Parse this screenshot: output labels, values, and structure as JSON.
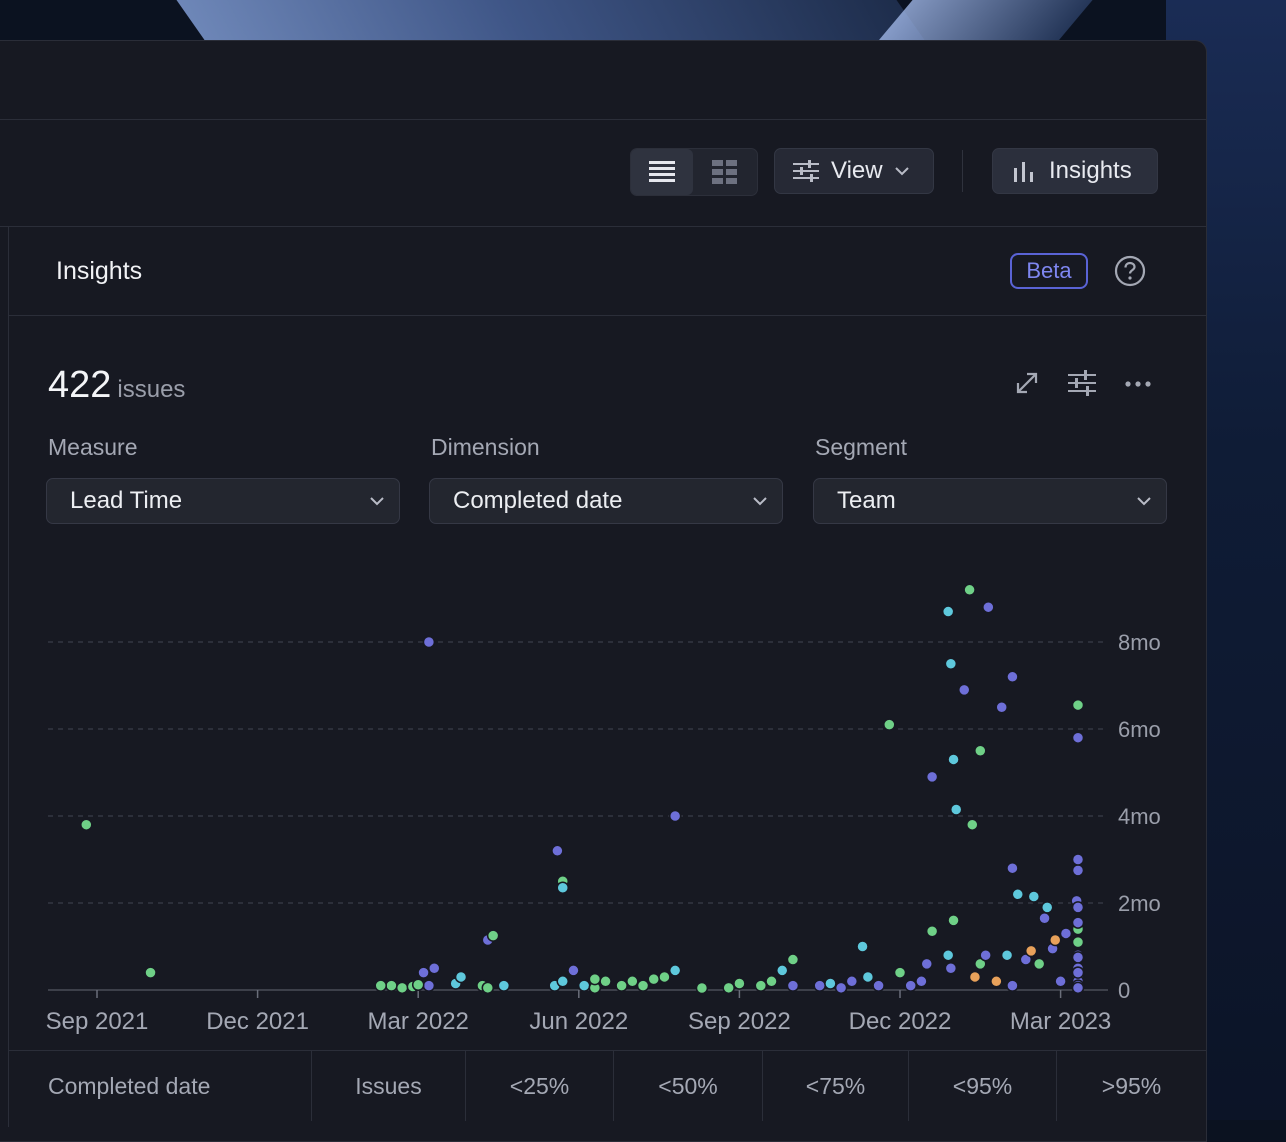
{
  "toolbar": {
    "view_label": "View",
    "insights_label": "Insights"
  },
  "panel": {
    "title": "Insights",
    "badge": "Beta"
  },
  "summary": {
    "count": "422",
    "unit": "issues"
  },
  "controls": {
    "measure": {
      "label": "Measure",
      "value": "Lead Time"
    },
    "dimension": {
      "label": "Dimension",
      "value": "Completed date"
    },
    "segment": {
      "label": "Segment",
      "value": "Team"
    }
  },
  "colors": {
    "accent": "#5a63d6",
    "series_purple": "#6e6fd8",
    "series_cyan": "#5ec8dc",
    "series_green": "#6fd087",
    "series_orange": "#e8a15a"
  },
  "chart_data": {
    "type": "scatter",
    "x_ticks": [
      "Sep 2021",
      "Dec 2021",
      "Mar 2022",
      "Jun 2022",
      "Sep 2022",
      "Dec 2022",
      "Mar 2023"
    ],
    "y_ticks": [
      "0",
      "2mo",
      "4mo",
      "6mo",
      "8mo"
    ],
    "ylim": [
      0,
      9.5
    ],
    "xlim": [
      -0.3,
      18.9
    ],
    "grid": true,
    "points": [
      {
        "x": -0.2,
        "y": 3.8,
        "c": "green"
      },
      {
        "x": 1.0,
        "y": 0.4,
        "c": "green"
      },
      {
        "x": 6.2,
        "y": 8.0,
        "c": "purple"
      },
      {
        "x": 6.2,
        "y": 0.1,
        "c": "purple"
      },
      {
        "x": 6.1,
        "y": 0.4,
        "c": "purple"
      },
      {
        "x": 6.3,
        "y": 0.5,
        "c": "purple"
      },
      {
        "x": 5.5,
        "y": 0.1,
        "c": "green"
      },
      {
        "x": 5.7,
        "y": 0.05,
        "c": "green"
      },
      {
        "x": 5.9,
        "y": 0.08,
        "c": "green"
      },
      {
        "x": 6.0,
        "y": 0.12,
        "c": "green"
      },
      {
        "x": 5.3,
        "y": 0.1,
        "c": "green"
      },
      {
        "x": 6.7,
        "y": 0.15,
        "c": "cyan"
      },
      {
        "x": 6.8,
        "y": 0.3,
        "c": "cyan"
      },
      {
        "x": 7.3,
        "y": 1.15,
        "c": "purple"
      },
      {
        "x": 7.4,
        "y": 1.25,
        "c": "green"
      },
      {
        "x": 7.2,
        "y": 0.1,
        "c": "green"
      },
      {
        "x": 7.3,
        "y": 0.05,
        "c": "green"
      },
      {
        "x": 7.6,
        "y": 0.1,
        "c": "cyan"
      },
      {
        "x": 8.6,
        "y": 3.2,
        "c": "purple"
      },
      {
        "x": 8.7,
        "y": 2.5,
        "c": "green"
      },
      {
        "x": 8.7,
        "y": 2.35,
        "c": "cyan"
      },
      {
        "x": 8.55,
        "y": 0.1,
        "c": "cyan"
      },
      {
        "x": 8.7,
        "y": 0.2,
        "c": "cyan"
      },
      {
        "x": 8.9,
        "y": 0.45,
        "c": "purple"
      },
      {
        "x": 9.1,
        "y": 0.1,
        "c": "cyan"
      },
      {
        "x": 9.3,
        "y": 0.05,
        "c": "green"
      },
      {
        "x": 9.5,
        "y": 0.2,
        "c": "green"
      },
      {
        "x": 9.3,
        "y": 0.25,
        "c": "green"
      },
      {
        "x": 9.8,
        "y": 0.1,
        "c": "green"
      },
      {
        "x": 10.0,
        "y": 0.2,
        "c": "green"
      },
      {
        "x": 10.2,
        "y": 0.1,
        "c": "green"
      },
      {
        "x": 10.4,
        "y": 0.25,
        "c": "green"
      },
      {
        "x": 10.6,
        "y": 0.3,
        "c": "green"
      },
      {
        "x": 10.8,
        "y": 0.45,
        "c": "cyan"
      },
      {
        "x": 10.8,
        "y": 4.0,
        "c": "purple"
      },
      {
        "x": 11.3,
        "y": 0.0,
        "c": "green"
      },
      {
        "x": 11.8,
        "y": 0.05,
        "c": "green"
      },
      {
        "x": 12.0,
        "y": 0.15,
        "c": "green"
      },
      {
        "x": 12.4,
        "y": 0.1,
        "c": "green"
      },
      {
        "x": 12.6,
        "y": 0.2,
        "c": "green"
      },
      {
        "x": 12.8,
        "y": 0.45,
        "c": "cyan"
      },
      {
        "x": 13.0,
        "y": 0.7,
        "c": "green"
      },
      {
        "x": 13.0,
        "y": 0.1,
        "c": "purple"
      },
      {
        "x": 13.5,
        "y": 0.1,
        "c": "purple"
      },
      {
        "x": 13.7,
        "y": 0.15,
        "c": "cyan"
      },
      {
        "x": 13.9,
        "y": 0.05,
        "c": "purple"
      },
      {
        "x": 14.1,
        "y": 0.2,
        "c": "purple"
      },
      {
        "x": 14.3,
        "y": 1.0,
        "c": "cyan"
      },
      {
        "x": 14.4,
        "y": 0.3,
        "c": "cyan"
      },
      {
        "x": 14.6,
        "y": 0.1,
        "c": "purple"
      },
      {
        "x": 14.8,
        "y": 6.1,
        "c": "green"
      },
      {
        "x": 15.0,
        "y": 0.4,
        "c": "green"
      },
      {
        "x": 15.2,
        "y": 0.1,
        "c": "purple"
      },
      {
        "x": 15.4,
        "y": 0.2,
        "c": "purple"
      },
      {
        "x": 15.5,
        "y": 0.6,
        "c": "purple"
      },
      {
        "x": 15.6,
        "y": 4.9,
        "c": "purple"
      },
      {
        "x": 15.6,
        "y": 1.35,
        "c": "green"
      },
      {
        "x": 15.9,
        "y": 8.7,
        "c": "cyan"
      },
      {
        "x": 15.95,
        "y": 7.5,
        "c": "cyan"
      },
      {
        "x": 16.0,
        "y": 5.3,
        "c": "cyan"
      },
      {
        "x": 16.05,
        "y": 4.15,
        "c": "cyan"
      },
      {
        "x": 16.0,
        "y": 1.6,
        "c": "green"
      },
      {
        "x": 15.9,
        "y": 0.8,
        "c": "cyan"
      },
      {
        "x": 15.95,
        "y": 0.5,
        "c": "purple"
      },
      {
        "x": 16.2,
        "y": 6.9,
        "c": "purple"
      },
      {
        "x": 16.3,
        "y": 9.2,
        "c": "green"
      },
      {
        "x": 16.35,
        "y": 3.8,
        "c": "green"
      },
      {
        "x": 16.4,
        "y": 0.3,
        "c": "orange"
      },
      {
        "x": 16.5,
        "y": 5.5,
        "c": "green"
      },
      {
        "x": 16.5,
        "y": 0.6,
        "c": "green"
      },
      {
        "x": 16.6,
        "y": 0.8,
        "c": "purple"
      },
      {
        "x": 16.65,
        "y": 8.8,
        "c": "purple"
      },
      {
        "x": 16.8,
        "y": 0.2,
        "c": "orange"
      },
      {
        "x": 16.9,
        "y": 6.5,
        "c": "purple"
      },
      {
        "x": 17.0,
        "y": 0.8,
        "c": "cyan"
      },
      {
        "x": 17.1,
        "y": 7.2,
        "c": "purple"
      },
      {
        "x": 17.1,
        "y": 2.8,
        "c": "purple"
      },
      {
        "x": 17.1,
        "y": 0.1,
        "c": "purple"
      },
      {
        "x": 17.2,
        "y": 2.2,
        "c": "cyan"
      },
      {
        "x": 17.35,
        "y": 0.7,
        "c": "purple"
      },
      {
        "x": 17.45,
        "y": 0.9,
        "c": "orange"
      },
      {
        "x": 17.5,
        "y": 2.15,
        "c": "cyan"
      },
      {
        "x": 17.6,
        "y": 0.6,
        "c": "green"
      },
      {
        "x": 17.7,
        "y": 1.65,
        "c": "purple"
      },
      {
        "x": 17.75,
        "y": 1.9,
        "c": "cyan"
      },
      {
        "x": 17.85,
        "y": 0.95,
        "c": "purple"
      },
      {
        "x": 17.9,
        "y": 1.15,
        "c": "orange"
      },
      {
        "x": 18.0,
        "y": 0.2,
        "c": "purple"
      },
      {
        "x": 18.1,
        "y": 1.3,
        "c": "purple"
      },
      {
        "x": 18.3,
        "y": 2.05,
        "c": "purple"
      },
      {
        "x": 18.35,
        "y": 0.5,
        "c": "purple"
      },
      {
        "x": 18.5,
        "y": 2.75,
        "c": "purple"
      },
      {
        "x": 18.55,
        "y": 1.55,
        "c": "cyan"
      },
      {
        "x": 18.6,
        "y": 0.3,
        "c": "green"
      },
      {
        "x": 18.75,
        "y": 1.9,
        "c": "purple"
      },
      {
        "x": 18.85,
        "y": 1.1,
        "c": "green"
      },
      {
        "x": 18.9,
        "y": 6.55,
        "c": "green"
      },
      {
        "x": 18.95,
        "y": 0.8,
        "c": "purple"
      },
      {
        "x": 19.1,
        "y": 0.1,
        "c": "purple"
      },
      {
        "x": 19.25,
        "y": 3.0,
        "c": "purple"
      },
      {
        "x": 19.3,
        "y": 1.4,
        "c": "green"
      },
      {
        "x": 19.4,
        "y": 0.4,
        "c": "purple"
      },
      {
        "x": 19.6,
        "y": 0.1,
        "c": "purple"
      },
      {
        "x": 19.8,
        "y": 0.2,
        "c": "purple"
      },
      {
        "x": 19.95,
        "y": 5.8,
        "c": "purple"
      },
      {
        "x": 19.95,
        "y": 0.4,
        "c": "purple"
      },
      {
        "x": 20.0,
        "y": 0.75,
        "c": "purple"
      },
      {
        "x": 20.1,
        "y": 0.1,
        "c": "purple"
      },
      {
        "x": 20.15,
        "y": 1.55,
        "c": "purple"
      },
      {
        "x": 20.2,
        "y": 0.05,
        "c": "purple"
      }
    ]
  },
  "table": {
    "columns": [
      "Completed date",
      "Issues",
      "<25%",
      "<50%",
      "<75%",
      "<95%",
      ">95%"
    ]
  }
}
